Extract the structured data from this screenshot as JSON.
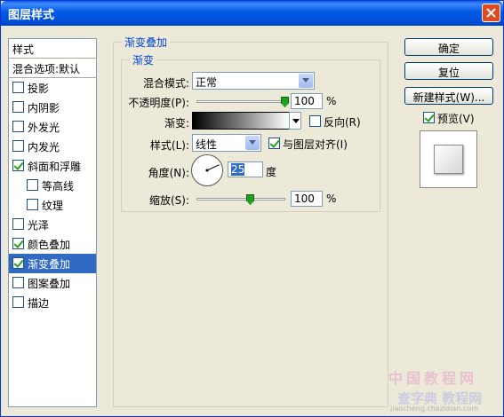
{
  "window": {
    "title": "图层样式"
  },
  "styles_panel": {
    "header": "样式",
    "blend_options": "混合选项:默认",
    "items": [
      {
        "label": "投影",
        "checked": false,
        "sub": false,
        "selected": false
      },
      {
        "label": "内阴影",
        "checked": false,
        "sub": false,
        "selected": false
      },
      {
        "label": "外发光",
        "checked": false,
        "sub": false,
        "selected": false
      },
      {
        "label": "内发光",
        "checked": false,
        "sub": false,
        "selected": false
      },
      {
        "label": "斜面和浮雕",
        "checked": true,
        "sub": false,
        "selected": false
      },
      {
        "label": "等高线",
        "checked": false,
        "sub": true,
        "selected": false
      },
      {
        "label": "纹理",
        "checked": false,
        "sub": true,
        "selected": false
      },
      {
        "label": "光泽",
        "checked": false,
        "sub": false,
        "selected": false
      },
      {
        "label": "颜色叠加",
        "checked": true,
        "sub": false,
        "selected": false
      },
      {
        "label": "渐变叠加",
        "checked": true,
        "sub": false,
        "selected": true
      },
      {
        "label": "图案叠加",
        "checked": false,
        "sub": false,
        "selected": false
      },
      {
        "label": "描边",
        "checked": false,
        "sub": false,
        "selected": false
      }
    ]
  },
  "gradient_overlay": {
    "group_title": "渐变叠加",
    "subgroup_title": "渐变",
    "blend_mode_label": "混合模式:",
    "blend_mode_value": "正常",
    "opacity_label": "不透明度(P):",
    "opacity_value": "100",
    "opacity_unit": "%",
    "gradient_label": "渐变:",
    "reverse_label": "反向(R)",
    "reverse_checked": false,
    "style_label": "样式(L):",
    "style_value": "线性",
    "align_label": "与图层对齐(I)",
    "align_checked": true,
    "angle_label": "角度(N):",
    "angle_value": "25",
    "angle_unit": "度",
    "scale_label": "缩放(S):",
    "scale_value": "100",
    "scale_unit": "%",
    "opacity_level": 1.0,
    "scale_level": 0.5
  },
  "buttons": {
    "ok": "确定",
    "reset": "复位",
    "new_style": "新建样式(W)...",
    "preview_label": "预览(V)",
    "preview_checked": true
  },
  "watermark": {
    "line1": "中国教程网",
    "line2": "查字典 教程网",
    "line3": "jiaocheng.chazidian.com"
  },
  "colors": {
    "title_bar": "#0058e6",
    "selection": "#316ac5",
    "group_label": "#0046d5"
  }
}
